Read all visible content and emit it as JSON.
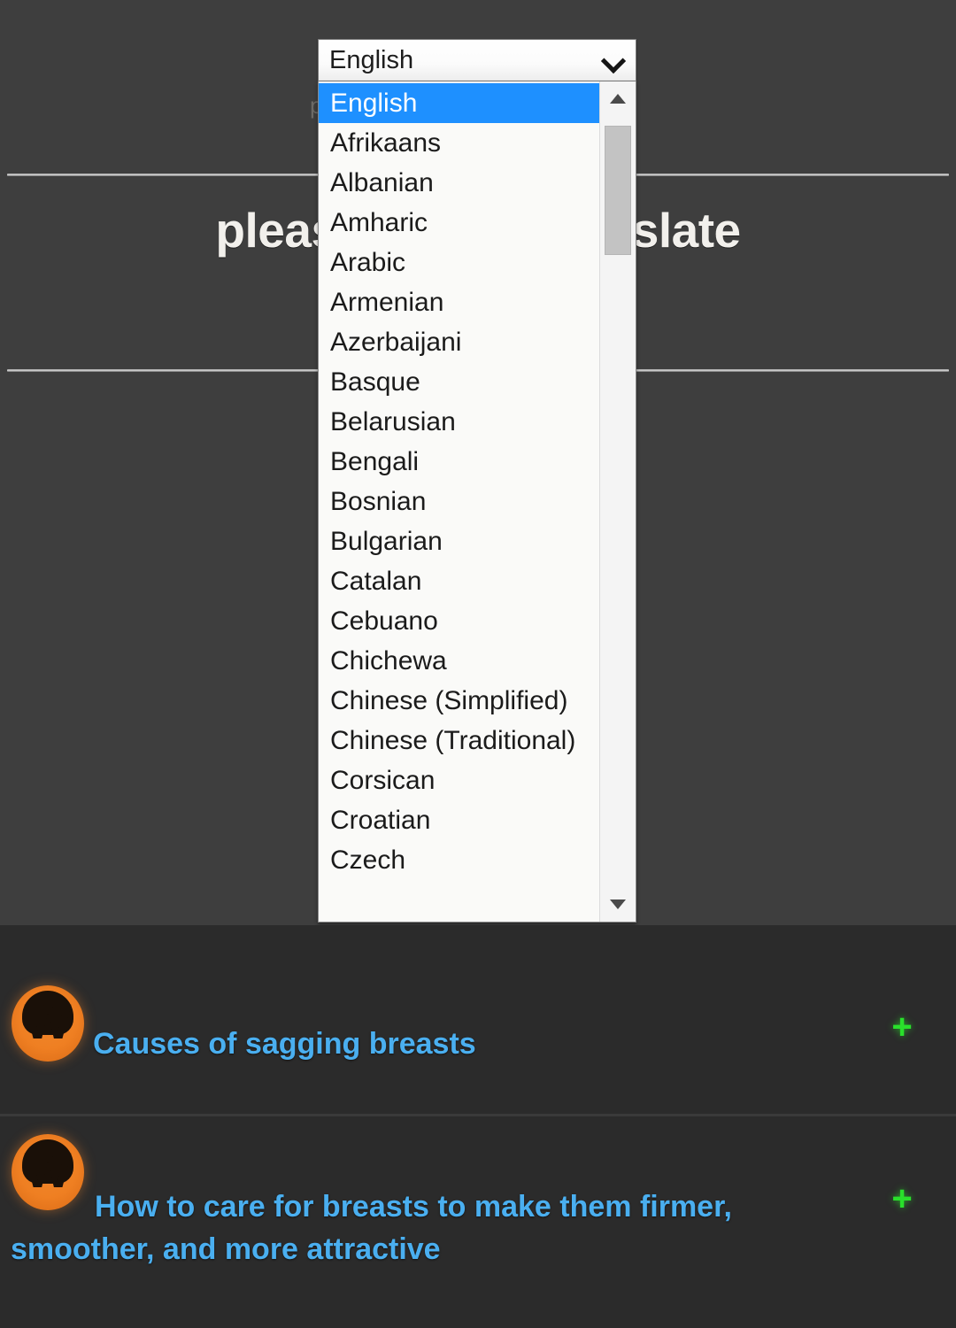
{
  "page": {
    "background_color": "#3e3e3e",
    "panel_color": "#2b2b2b"
  },
  "translate": {
    "heading": "please wait to translate",
    "obscured_fragment": "p",
    "language_select": {
      "label": "language-select",
      "selected": "English",
      "expanded": true,
      "options": [
        "English",
        "Afrikaans",
        "Albanian",
        "Amharic",
        "Arabic",
        "Armenian",
        "Azerbaijani",
        "Basque",
        "Belarusian",
        "Bengali",
        "Bosnian",
        "Bulgarian",
        "Catalan",
        "Cebuano",
        "Chichewa",
        "Chinese (Simplified)",
        "Chinese (Traditional)",
        "Corsican",
        "Croatian",
        "Czech"
      ],
      "highlight_color": "#1e90ff",
      "chevron_icon": "chevron-down-icon",
      "scrollbar": {
        "up_arrow_icon": "scroll-up-arrow-icon",
        "down_arrow_icon": "scroll-down-arrow-icon"
      }
    }
  },
  "articles": {
    "link_color": "#4aaff0",
    "expand_icon": "plus-icon",
    "expand_icon_color": "#29e02b",
    "items": [
      {
        "icon": "wikihow-logo-icon",
        "title": "Causes of sagging breasts",
        "expand": "+"
      },
      {
        "icon": "wikihow-logo-icon",
        "title": "How to care for breasts to make them firmer, smoother, and more attractive",
        "expand": "+"
      }
    ]
  }
}
